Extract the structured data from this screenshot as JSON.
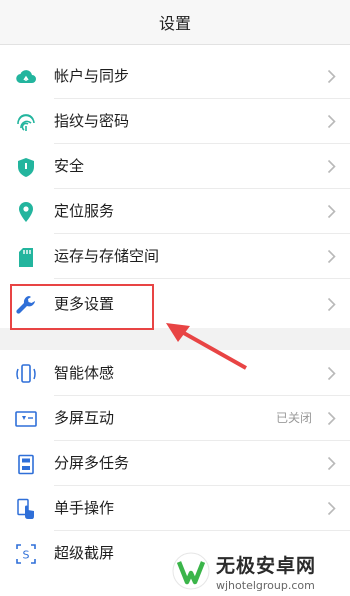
{
  "header": {
    "title": "设置"
  },
  "group1": [
    {
      "label": "帐户与同步",
      "icon": "cloud-sync-icon"
    },
    {
      "label": "指纹与密码",
      "icon": "fingerprint-icon"
    },
    {
      "label": "安全",
      "icon": "shield-icon"
    },
    {
      "label": "定位服务",
      "icon": "location-pin-icon"
    },
    {
      "label": "运存与存储空间",
      "icon": "sd-card-icon"
    },
    {
      "label": "更多设置",
      "icon": "wrench-icon"
    }
  ],
  "group2": [
    {
      "label": "智能体感",
      "icon": "phone-motion-icon",
      "value": ""
    },
    {
      "label": "多屏互动",
      "icon": "screen-cast-icon",
      "value": "已关闭"
    },
    {
      "label": "分屏多任务",
      "icon": "split-screen-icon",
      "value": ""
    },
    {
      "label": "单手操作",
      "icon": "one-hand-icon",
      "value": ""
    },
    {
      "label": "超级截屏",
      "icon": "screenshot-icon",
      "value": ""
    }
  ],
  "watermark": {
    "brand": "无极安卓网",
    "url": "wjhotelgroup.com"
  },
  "colors": {
    "accent_green": "#23b59e",
    "icon_blue": "#2f6fd8",
    "annotation_red": "#e84444"
  }
}
